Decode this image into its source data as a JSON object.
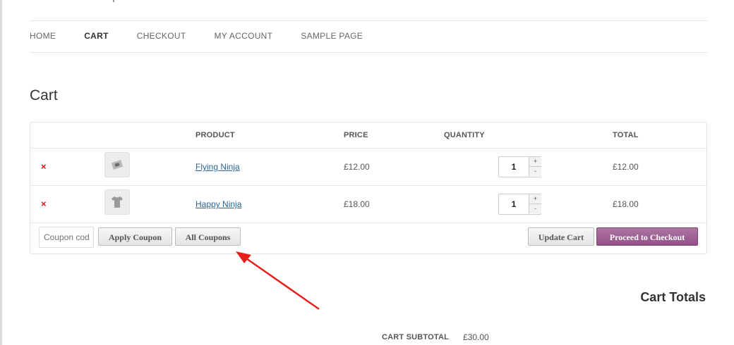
{
  "nav": {
    "items": [
      {
        "label": "HOME"
      },
      {
        "label": "CART"
      },
      {
        "label": "CHECKOUT"
      },
      {
        "label": "MY ACCOUNT"
      },
      {
        "label": "SAMPLE PAGE"
      }
    ],
    "active": "CART"
  },
  "page": {
    "title": "Cart"
  },
  "cart": {
    "headers": {
      "product": "PRODUCT",
      "price": "PRICE",
      "quantity": "QUANTITY",
      "total": "TOTAL"
    },
    "rows": [
      {
        "remove": "×",
        "product": "Flying Ninja",
        "price": "£12.00",
        "qty": "1",
        "total": "£12.00",
        "thumb_icon": "poster-icon"
      },
      {
        "remove": "×",
        "product": "Happy Ninja",
        "price": "£18.00",
        "qty": "1",
        "total": "£18.00",
        "thumb_icon": "tshirt-icon"
      }
    ],
    "coupon_placeholder": "Coupon code",
    "apply_coupon": "Apply Coupon",
    "all_coupons": "All Coupons",
    "update_cart": "Update Cart",
    "proceed": "Proceed to Checkout"
  },
  "totals": {
    "title": "Cart Totals",
    "subtotal_label": "CART SUBTOTAL",
    "subtotal_value": "£30.00"
  },
  "colors": {
    "accent": "#9b5c8f",
    "remove": "#dd1111",
    "link": "#2a6496",
    "annotation": "#e8201c"
  }
}
